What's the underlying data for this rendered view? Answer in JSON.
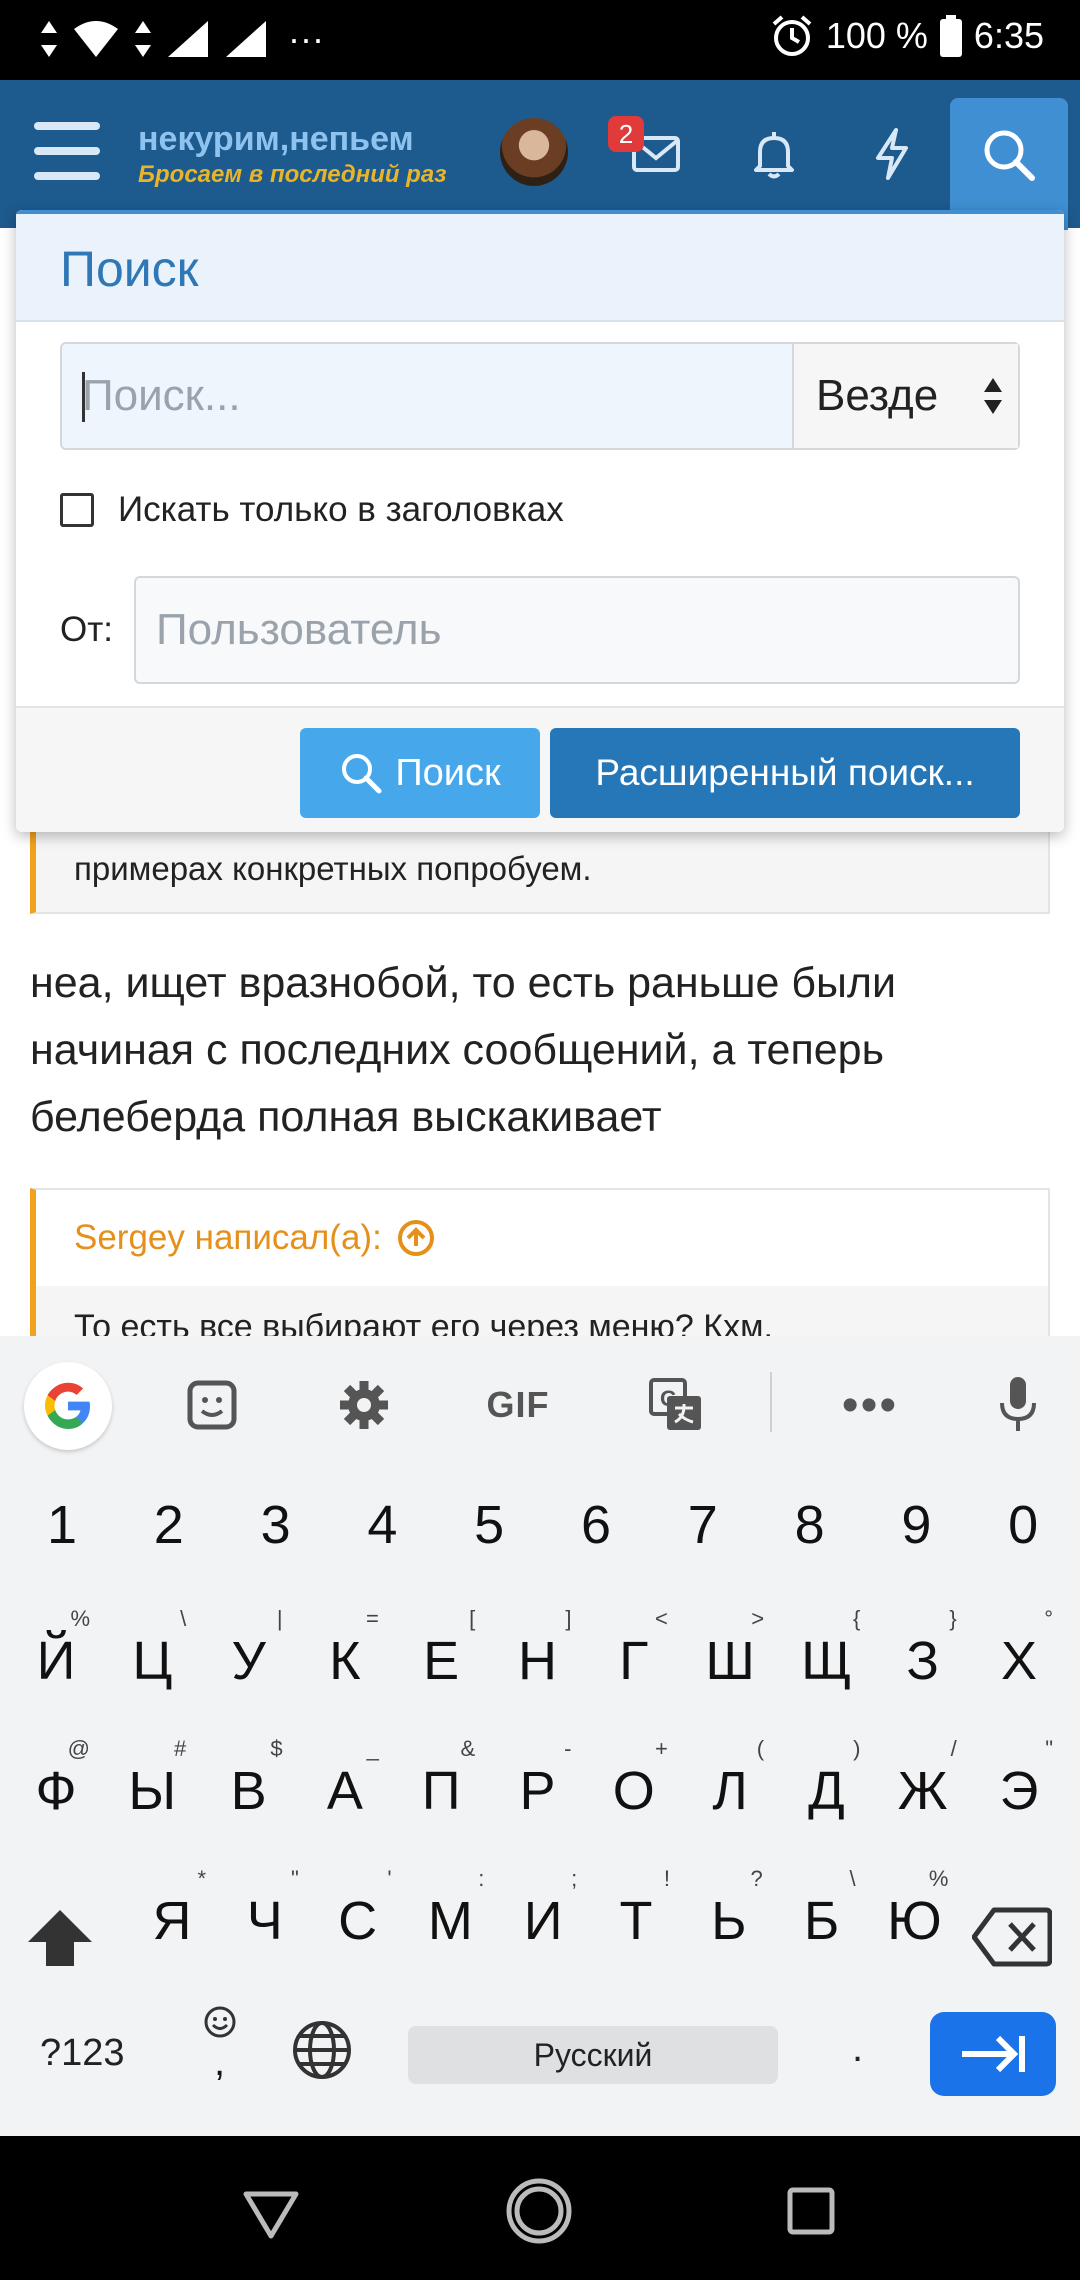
{
  "status_bar": {
    "battery": "100 %",
    "time": "6:35",
    "more": "···"
  },
  "header": {
    "logo_main": "некурим,непьем",
    "logo_sub": "Бросаем в последний раз",
    "inbox_badge": "2"
  },
  "background_content": {
    "quote1_text": "примерах конкретных попробуем.",
    "post_text": "неа, ищет вразнобой, то есть раньше были начиная с последних сообщений, а теперь белеберда полная выскакивает",
    "quote2_author": "Sergey написал(а):",
    "quote2_text": "То есть все выбирают его через меню? Кхм."
  },
  "search_popup": {
    "title": "Поиск",
    "query_placeholder": "Поиск...",
    "scope_selected": "Везде",
    "titles_only_label": "Искать только в заголовках",
    "titles_only_checked": false,
    "from_label": "От:",
    "user_placeholder": "Пользователь",
    "search_button": "Поиск",
    "advanced_button": "Расширенный поиск..."
  },
  "keyboard": {
    "toolbar": {
      "gif": "GIF",
      "more": "•••"
    },
    "numbers": [
      "1",
      "2",
      "3",
      "4",
      "5",
      "6",
      "7",
      "8",
      "9",
      "0"
    ],
    "row1": [
      {
        "k": "Й",
        "h": "%"
      },
      {
        "k": "Ц",
        "h": "\\"
      },
      {
        "k": "У",
        "h": "|"
      },
      {
        "k": "К",
        "h": "="
      },
      {
        "k": "Е",
        "h": "["
      },
      {
        "k": "Н",
        "h": "]"
      },
      {
        "k": "Г",
        "h": "<"
      },
      {
        "k": "Ш",
        "h": ">"
      },
      {
        "k": "Щ",
        "h": "{"
      },
      {
        "k": "З",
        "h": "}"
      },
      {
        "k": "Х",
        "h": "°"
      }
    ],
    "row2": [
      {
        "k": "Ф",
        "h": "@"
      },
      {
        "k": "Ы",
        "h": "#"
      },
      {
        "k": "В",
        "h": "$"
      },
      {
        "k": "А",
        "h": "_"
      },
      {
        "k": "П",
        "h": "&"
      },
      {
        "k": "Р",
        "h": "-"
      },
      {
        "k": "О",
        "h": "+"
      },
      {
        "k": "Л",
        "h": "("
      },
      {
        "k": "Д",
        "h": ")"
      },
      {
        "k": "Ж",
        "h": "/"
      },
      {
        "k": "Э",
        "h": "\""
      }
    ],
    "row3": [
      {
        "k": "Я",
        "h": "*"
      },
      {
        "k": "Ч",
        "h": "\""
      },
      {
        "k": "С",
        "h": "'"
      },
      {
        "k": "М",
        "h": ":"
      },
      {
        "k": "И",
        "h": ";"
      },
      {
        "k": "Т",
        "h": "!"
      },
      {
        "k": "Ь",
        "h": "?"
      },
      {
        "k": "Б",
        "h": "\\"
      },
      {
        "k": "Ю",
        "h": "%"
      }
    ],
    "symbols_key": "?123",
    "emoji_comma": ",",
    "space_label": "Русский",
    "period": "."
  }
}
